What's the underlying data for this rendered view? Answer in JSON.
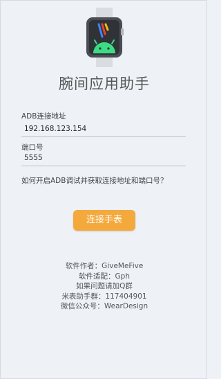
{
  "app": {
    "title": "腕间应用助手"
  },
  "adb_address": {
    "label": "ADB连接地址",
    "value": "192.168.123.154"
  },
  "port": {
    "label": "端口号",
    "value": "5555"
  },
  "help_link": "如何开启ADB调试并获取连接地址和端口号？",
  "connect_button": "连接手表",
  "info": [
    "软件作者：GiveMeFive",
    "软件适配：Gph",
    "如果问题请加Q群",
    "米表助手群：117404901",
    "微信公众号：WearDesign"
  ],
  "colors": {
    "background": "#eef2f7",
    "accent": "#f4a93d",
    "android_green": "#3ddc84"
  }
}
